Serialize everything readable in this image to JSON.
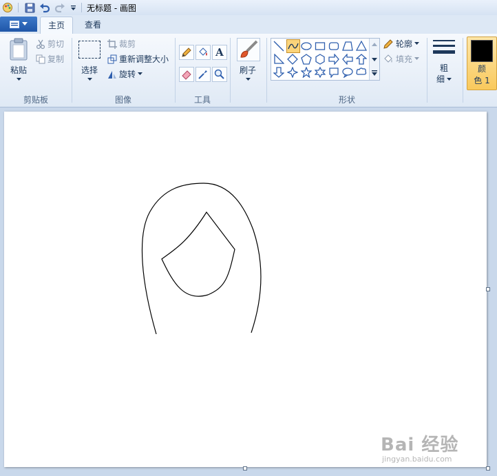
{
  "title_bar": {
    "title": "无标题 - 画图"
  },
  "tabs": [
    {
      "label": "主页",
      "active": true
    },
    {
      "label": "查看",
      "active": false
    }
  ],
  "clipboard": {
    "paste_label": "粘贴",
    "cut_label": "剪切",
    "copy_label": "复制",
    "group_label": "剪贴板"
  },
  "image": {
    "select_label": "选择",
    "crop_label": "裁剪",
    "resize_label": "重新调整大小",
    "rotate_label": "旋转",
    "group_label": "图像"
  },
  "tools": {
    "group_label": "工具",
    "items": [
      "pencil-icon",
      "fill-bucket-icon",
      "text-icon",
      "eraser-icon",
      "color-picker-icon",
      "magnifier-icon"
    ],
    "text_glyph": "A"
  },
  "brush": {
    "label": "刷子"
  },
  "shapes": {
    "group_label": "形状",
    "outline_label": "轮廓",
    "fill_label": "填充",
    "selected": "curve-shape"
  },
  "size": {
    "label_line1": "粗",
    "label_line2": "细"
  },
  "color1": {
    "label_line1": "颜",
    "label_line2": "色 1",
    "value": "#000000"
  },
  "watermark": {
    "main": "Bai 经验",
    "sub": "jingyan.baidu.com"
  },
  "colors": {
    "accent_selected": "#fbd47b",
    "ribbon_text": "#1e395b"
  }
}
